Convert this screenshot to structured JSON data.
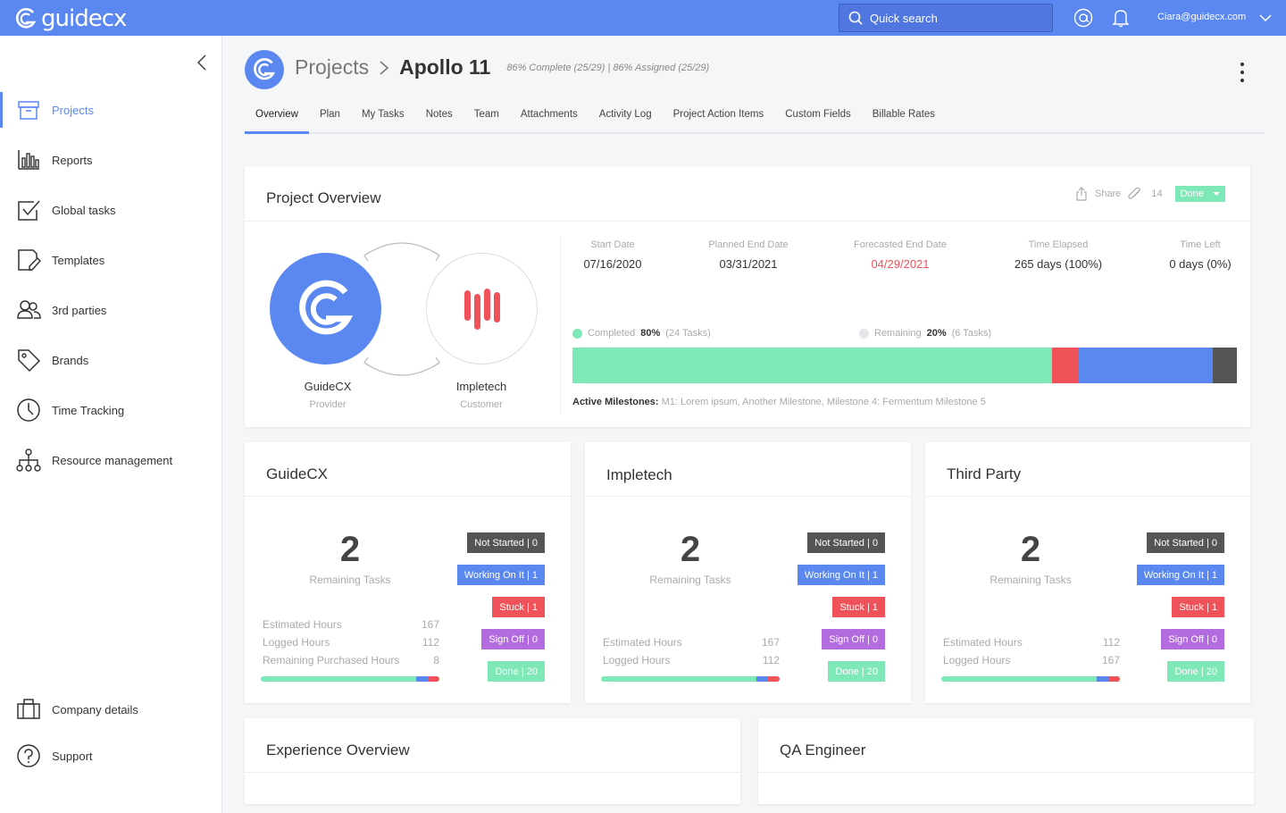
{
  "brand": {
    "name": "guidecx",
    "primary": "#5b87f0",
    "green": "#7ee8b7",
    "red": "#f0525a",
    "purple": "#b36ce0",
    "dark": "#555555"
  },
  "topbar": {
    "search_placeholder": "Quick search",
    "user_email": "Ciara@guidecx.com",
    "icons": [
      "at-icon",
      "bell-icon",
      "chevron-down-icon"
    ]
  },
  "sidebar": {
    "items": [
      {
        "label": "Projects",
        "icon": "folder-icon",
        "active": true
      },
      {
        "label": "Reports",
        "icon": "bar-chart-icon"
      },
      {
        "label": "Global tasks",
        "icon": "checkbox-icon"
      },
      {
        "label": "Templates",
        "icon": "document-edit-icon"
      },
      {
        "label": "3rd parties",
        "icon": "users-icon"
      },
      {
        "label": "Brands",
        "icon": "tag-icon"
      },
      {
        "label": "Time Tracking",
        "icon": "clock-icon"
      },
      {
        "label": "Resource management",
        "icon": "hierarchy-icon"
      }
    ],
    "bottom_items": [
      {
        "label": "Company details",
        "icon": "building-icon"
      },
      {
        "label": "Support",
        "icon": "help-icon"
      }
    ]
  },
  "header": {
    "parent": "Projects",
    "current": "Apollo 11",
    "stats": "86% Complete (25/29)  |  86% Assigned (25/29)"
  },
  "tabs": [
    "Overview",
    "Plan",
    "My Tasks",
    "Notes",
    "Team",
    "Attachments",
    "Activity Log",
    "Project Action Items",
    "Custom Fields",
    "Billable Rates"
  ],
  "overview": {
    "title": "Project Overview",
    "share_label": "Share",
    "attachments_count": "14",
    "status_label": "Done",
    "provider": {
      "name": "GuideCX",
      "role": "Provider"
    },
    "customer": {
      "name": "Impletech",
      "role": "Customer"
    },
    "dates": [
      {
        "label": "Start Date",
        "value": "07/16/2020",
        "warn": false
      },
      {
        "label": "Planned End Date",
        "value": "03/31/2021",
        "warn": false
      },
      {
        "label": "Forecasted End Date",
        "value": "04/29/2021",
        "warn": true
      },
      {
        "label": "Time Elapsed",
        "value": "265 days (100%)",
        "warn": false
      },
      {
        "label": "Time Left",
        "value": "0 days (0%)",
        "warn": false
      }
    ],
    "completed": {
      "label": "Completed",
      "pct": "80%",
      "tasks": "(24 Tasks)"
    },
    "remaining": {
      "label": "Remaining",
      "pct": "20%",
      "tasks": "(6 Tasks)"
    },
    "progress_segments": [
      {
        "status": "done",
        "fraction": 0.722,
        "color": "#7ee8b7"
      },
      {
        "status": "stuck",
        "fraction": 0.04,
        "color": "#f0525a"
      },
      {
        "status": "working",
        "fraction": 0.202,
        "color": "#5b87f0"
      },
      {
        "status": "not-started",
        "fraction": 0.036,
        "color": "#555555"
      }
    ],
    "milestones_label": "Active Milestones:",
    "milestones": "M1: Lorem ipsum, Another Milestone, Milestone 4: Fermentum Milestone 5"
  },
  "parties": [
    {
      "title": "GuideCX",
      "remaining_count": "2",
      "remaining_label": "Remaining Tasks",
      "hours": [
        {
          "label": "Estimated Hours",
          "value": "167"
        },
        {
          "label": "Logged Hours",
          "value": "112"
        },
        {
          "label": "Remaining Purchased Hours",
          "value": "8"
        }
      ],
      "badges": [
        "Not Started | 0",
        "Working On It | 1",
        "Stuck | 1",
        "Sign Off  | 0",
        "Done | 20"
      ],
      "bar": [
        0.87,
        0.065,
        0.065
      ]
    },
    {
      "title": "Impletech",
      "remaining_count": "2",
      "remaining_label": "Remaining Tasks",
      "hours": [
        {
          "label": "Estimated Hours",
          "value": "167"
        },
        {
          "label": "Logged Hours",
          "value": "112"
        }
      ],
      "badges": [
        "Not Started | 0",
        "Working On It | 1",
        "Stuck | 1",
        "Sign Off  | 0",
        "Done | 20"
      ],
      "bar": [
        0.87,
        0.065,
        0.065
      ]
    },
    {
      "title": "Third Party",
      "remaining_count": "2",
      "remaining_label": "Remaining Tasks",
      "hours": [
        {
          "label": "Estimated Hours",
          "value": "112"
        },
        {
          "label": "Logged Hours",
          "value": "167"
        }
      ],
      "badges": [
        "Not Started | 0",
        "Working On It | 1",
        "Stuck | 1",
        "Sign Off  | 0",
        "Done | 20"
      ],
      "bar": [
        0.87,
        0.065,
        0.065
      ]
    }
  ],
  "bottom_cards": [
    "Experience Overview",
    "QA Engineer"
  ]
}
